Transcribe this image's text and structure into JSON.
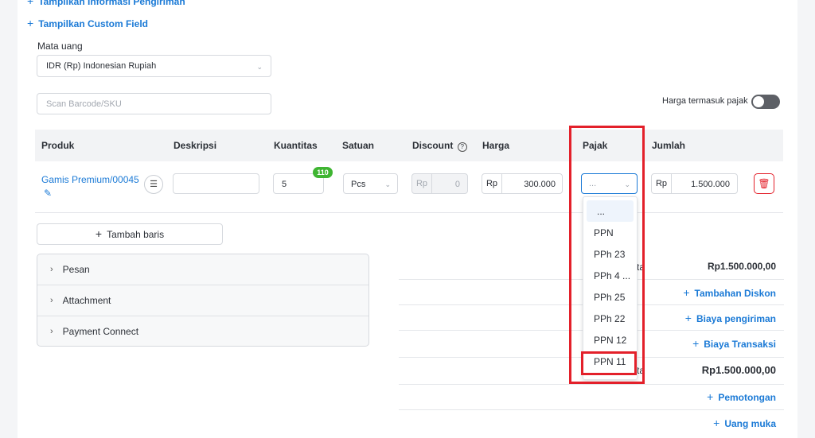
{
  "top_links": {
    "shipping_info": "Tampilkan Informasi Pengiriman",
    "custom_field": "Tampilkan Custom Field"
  },
  "currency": {
    "label": "Mata uang",
    "value": "IDR (Rp) Indonesian Rupiah"
  },
  "scan": {
    "placeholder": "Scan Barcode/SKU"
  },
  "tax_toggle": {
    "label": "Harga termasuk pajak"
  },
  "table": {
    "headers": {
      "product": "Produk",
      "description": "Deskripsi",
      "quantity": "Kuantitas",
      "unit": "Satuan",
      "discount": "Discount",
      "price": "Harga",
      "tax": "Pajak",
      "amount": "Jumlah"
    },
    "row": {
      "product": "Gamis Premium/00045",
      "stock_badge": "110",
      "quantity": "5",
      "unit": "Pcs",
      "discount_prefix": "Rp",
      "discount": "0",
      "price_prefix": "Rp",
      "price": "300.000",
      "tax_value": "...",
      "amount_prefix": "Rp",
      "amount": "1.500.000"
    }
  },
  "add_row": "Tambah baris",
  "accordion": [
    "Pesan",
    "Attachment",
    "Payment Connect"
  ],
  "summary": {
    "subtotal_label_partial": "ta",
    "subtotal": "Rp1.500.000,00",
    "add_discount": "Tambahan Diskon",
    "shipping_cost": "Biaya pengiriman",
    "transaction_cost": "Biaya Transaksi",
    "total_label_partial": "ta",
    "total": "Rp1.500.000,00",
    "deduction": "Pemotongan",
    "down_payment": "Uang muka"
  },
  "tax_dropdown": {
    "options": [
      "...",
      "PPN",
      "PPh 23",
      "PPh 4 ...",
      "PPh 25",
      "PPh 22",
      "PPN 12",
      "PPN 11"
    ],
    "highlighted": "PPN 11"
  },
  "colors": {
    "accent": "#1b7ad6",
    "highlight": "#e3202a",
    "badge": "#3fb532",
    "delete": "#e3202a"
  }
}
